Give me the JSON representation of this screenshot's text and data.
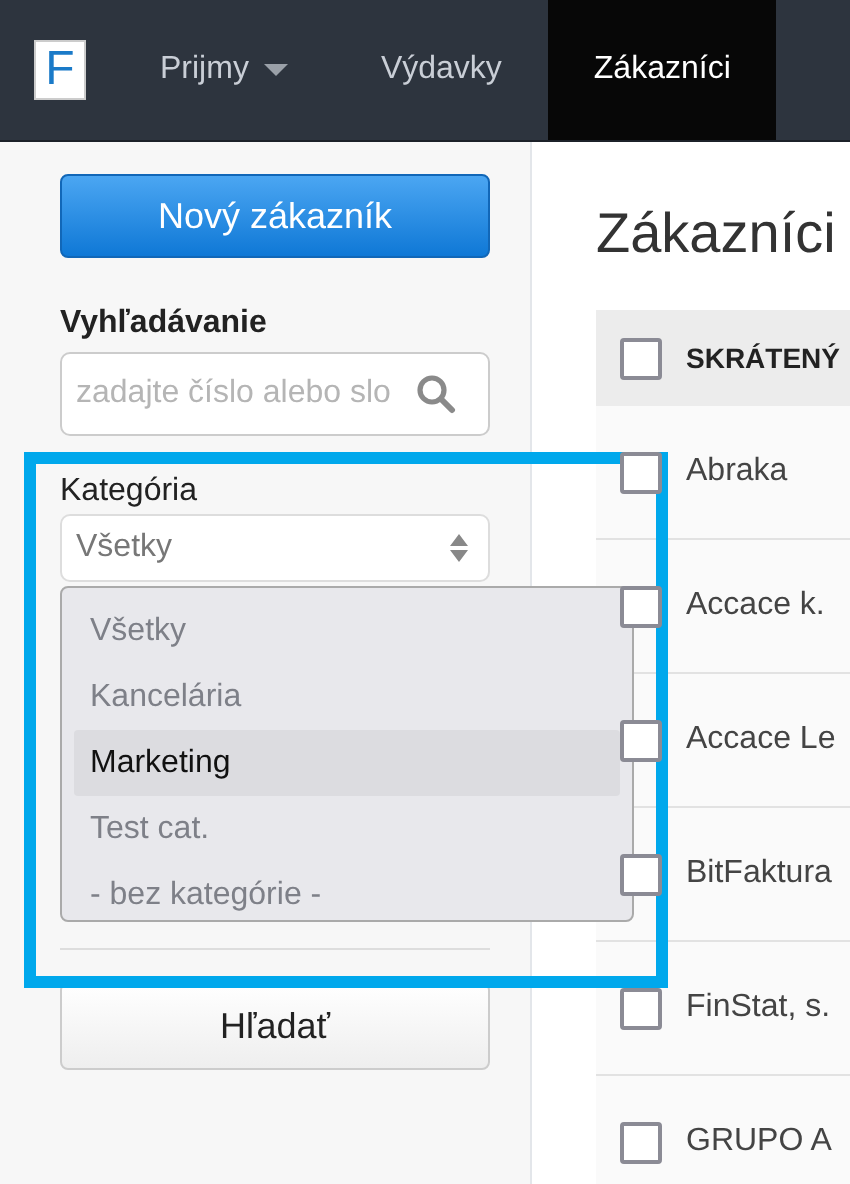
{
  "navbar": {
    "logo": "F",
    "items": [
      {
        "label": "Prijmy",
        "dropdown": true,
        "selected": false
      },
      {
        "label": "Výdavky",
        "dropdown": false,
        "selected": false
      },
      {
        "label": "Zákazníci",
        "dropdown": false,
        "selected": true
      }
    ]
  },
  "sidebar": {
    "new_button": "Nový zákazník",
    "search_label": "Vyhľadávanie",
    "search": {
      "placeholder": "zadajte číslo alebo slo"
    },
    "category_label": "Kategória",
    "category_value": "Všetky",
    "category_options": [
      {
        "label": "Všetky",
        "selected": false
      },
      {
        "label": "Kancelária",
        "selected": false
      },
      {
        "label": "Marketing",
        "selected": true
      },
      {
        "label": "Test cat.",
        "selected": false
      },
      {
        "label": "- bez kategórie -",
        "selected": false
      }
    ],
    "search_button": "Hľadať"
  },
  "main": {
    "title": "Zákazníci",
    "table": {
      "columns": [
        {
          "label": "SKRÁTENÝ",
          "checked": false
        }
      ],
      "rows": [
        {
          "name": "Abraka",
          "checked": false
        },
        {
          "name": "Accace k.",
          "checked": false
        },
        {
          "name": "Accace Le",
          "checked": false
        },
        {
          "name": "BitFaktura",
          "checked": false
        },
        {
          "name": "FinStat, s.",
          "checked": false
        },
        {
          "name": "GRUPO A",
          "checked": false
        }
      ]
    }
  }
}
